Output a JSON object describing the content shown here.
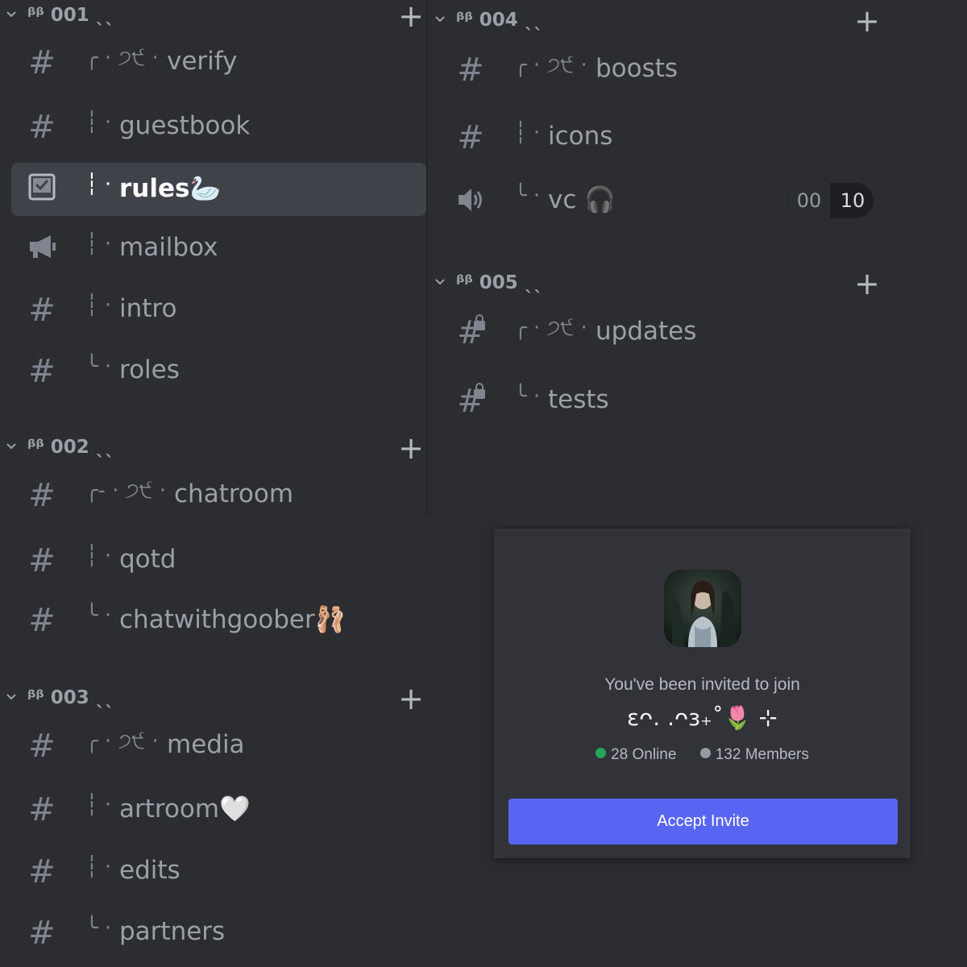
{
  "left_categories": [
    {
      "name": "ᵝᵝ 001 ˎˎ",
      "channels": [
        {
          "tree": "╭ · ੭੯ ·",
          "label": "verify",
          "icon": "hash-icon"
        },
        {
          "tree": "┆ ·",
          "label": "guestbook",
          "icon": "hash-icon"
        },
        {
          "tree": "┆ ·",
          "label": "rules🦢",
          "icon": "rules-icon",
          "selected": true
        },
        {
          "tree": "┆ ·",
          "label": "mailbox",
          "icon": "announcement-icon"
        },
        {
          "tree": "┆ ·",
          "label": "intro",
          "icon": "hash-icon"
        },
        {
          "tree": "╰ ·",
          "label": "roles",
          "icon": "hash-icon"
        }
      ]
    },
    {
      "name": "ᵝᵝ 002 ˎˎ",
      "channels": [
        {
          "tree": "╭- · ੭੯ ·",
          "label": "chatroom",
          "icon": "hash-icon"
        },
        {
          "tree": "┆ ·",
          "label": "qotd",
          "icon": "hash-icon"
        },
        {
          "tree": "╰ ·",
          "label": "chatwithgoober🩰",
          "icon": "hash-icon"
        }
      ]
    },
    {
      "name": "ᵝᵝ 003 ˎˎ",
      "channels": [
        {
          "tree": "╭ · ੭੯ ·",
          "label": "media",
          "icon": "hash-icon"
        },
        {
          "tree": "┆ ·",
          "label": "artroom🤍",
          "icon": "hash-icon"
        },
        {
          "tree": "┆ ·",
          "label": "edits",
          "icon": "hash-icon"
        },
        {
          "tree": "╰ ·",
          "label": "partners",
          "icon": "hash-icon"
        }
      ]
    }
  ],
  "right_categories": [
    {
      "name": "ᵝᵝ 004 ˎˎ",
      "channels": [
        {
          "tree": "╭ · ੭੯ ·",
          "label": "boosts",
          "icon": "hash-icon"
        },
        {
          "tree": "┆ ·",
          "label": "icons",
          "icon": "hash-icon"
        },
        {
          "tree": "╰  ·",
          "label": "vc 🎧",
          "icon": "speaker-icon",
          "count_current": "00",
          "count_limit": "10"
        }
      ]
    },
    {
      "name": "ᵝᵝ 005 ˎˎ",
      "channels": [
        {
          "tree": "╭ · ੭੯ ·",
          "label": "updates",
          "icon": "locked-hash-icon"
        },
        {
          "tree": "╰ ·",
          "label": "tests",
          "icon": "locked-hash-icon"
        }
      ]
    }
  ],
  "plus_glyph": "+",
  "invite": {
    "heading": "You've been invited to join",
    "server_name": "εᴖ. .ᴖз₊˚🌷 ⊹",
    "online": "28 Online",
    "members": "132 Members",
    "accept_label": "Accept Invite",
    "online_color": "#23a55a",
    "members_color": "#949ba4",
    "button_color": "#5865f2"
  }
}
